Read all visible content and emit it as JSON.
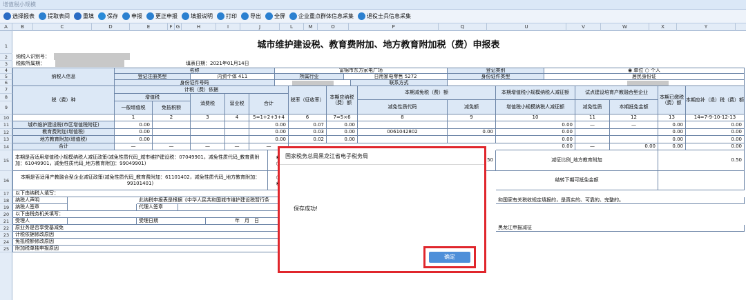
{
  "window": {
    "title": "增值税小规模"
  },
  "toolbar": [
    {
      "label": "选择报表",
      "icon": "list-icon",
      "color": "#2b6cc4"
    },
    {
      "label": "提取表间",
      "icon": "arrow-icon",
      "color": "#2b80d0"
    },
    {
      "label": "重填",
      "icon": "close-icon",
      "color": "#2b6cc4"
    },
    {
      "label": "保存",
      "icon": "check-icon",
      "color": "#2a8bd8"
    },
    {
      "label": "申报",
      "icon": "upload-icon",
      "color": "#2b80d0"
    },
    {
      "label": "更正申报",
      "icon": "cloud-icon",
      "color": "#2b80d0"
    },
    {
      "label": "填报说明",
      "icon": "help-icon",
      "color": "#2b80d0"
    },
    {
      "label": "打印",
      "icon": "printer-icon",
      "color": "#2b80d0"
    },
    {
      "label": "导出",
      "icon": "export-icon",
      "color": "#2b80d0"
    },
    {
      "label": "全屏",
      "icon": "fullscreen-icon",
      "color": "#2b80d0"
    },
    {
      "label": "企业重点群体信息采集",
      "icon": "cloud-icon",
      "color": "#2b80d0"
    },
    {
      "label": "退役士兵信息采集",
      "icon": "cloud-icon",
      "color": "#2b80d0"
    }
  ],
  "columns": [
    "A",
    "B",
    "C",
    "D",
    "E",
    "F",
    "G",
    "H",
    "I",
    "J",
    "L",
    "M",
    "O",
    "P",
    "Q",
    "U",
    "V",
    "W",
    "X",
    "Y"
  ],
  "rows": [
    "1",
    "2",
    "3",
    "4",
    "5",
    "6",
    "7",
    "8",
    "9",
    "10",
    "11",
    "12",
    "13",
    "14",
    "15",
    "16",
    "17",
    "18",
    "19",
    "20",
    "21",
    "22",
    "23",
    "24",
    "25"
  ],
  "form": {
    "title": "城市维护建设税、教育费附加、地方教育附加税（费）申报表",
    "taxpayer_id_label": "纳税人识别号：",
    "period_label": "税款所属期：",
    "fill_date": "填表日期：2021年01月14日",
    "info_label": "纳税人信息",
    "name_label": "名称",
    "name_value": "富锦市东方家电广场",
    "reg_label": "登记注册类型",
    "reg_value": "内资个体 411",
    "industry_label": "所属行业",
    "industry_value": "日用家电零售 5272",
    "idtype_label": "身份证件类型",
    "idno_label": "身份证件号码",
    "contact_label": "联系方式",
    "category_label": "登记类别",
    "unit_label": "单位",
    "individual_label": "个人",
    "id_type_value": "居民身份证",
    "tax_type_label": "税（费）种",
    "basis_label": "计税（费）依据",
    "vat_label": "增值税",
    "general_vat": "一般增值税",
    "exempt_vat": "免抵税额",
    "consumption_tax": "消费税",
    "business_tax": "营业税",
    "total": "合计",
    "rate_label": "税率（征收率）",
    "payable_label": "本期应纳税（费）额",
    "reduce_label": "本期减免税（费）额",
    "reduce_code": "减免性质代码",
    "reduce_amount": "减免额",
    "small_label": "本期增值税小规模纳税人减征额",
    "small_sub": "增值税小规模纳税人减征额",
    "pilot_label": "试点建设培育产教融合型企业",
    "pilot_code": "减免性质",
    "pilot_amount": "本期抵免金额",
    "paid_label": "本期已缴税（费）额",
    "due_label": "本期应补（退）税（费）额",
    "idx": [
      "1",
      "2",
      "3",
      "4",
      "5=1+2+3+4",
      "6",
      "7=5×6",
      "8",
      "9",
      "10",
      "11",
      "12",
      "13",
      "14=7-9-10-12-13"
    ],
    "rows": [
      {
        "name": "城市维护建设税(市区增值税附征)",
        "amt": "0.00",
        "total": "0.00",
        "rate": "0.07",
        "payable": "0.00",
        "code": "",
        "reduce": "",
        "small": "0.00",
        "pcode": "—",
        "pamt": "—",
        "paid": "0.00",
        "due": "0.00"
      },
      {
        "name": "教育费附加(增值税)",
        "amt": "0.00",
        "total": "0.00",
        "rate": "0.03",
        "payable": "0.00",
        "code": "0061042802",
        "reduce": "0.00",
        "small": "0.00",
        "pcode": "",
        "pamt": "",
        "paid": "0.00",
        "due": "0.00"
      },
      {
        "name": "地方教育附加(增值税)",
        "amt": "0.00",
        "total": "0.00",
        "rate": "0.02",
        "payable": "0.00",
        "code": "",
        "reduce": "",
        "small": "0.00",
        "pcode": "",
        "pamt": "",
        "paid": "0.00",
        "due": "0.00"
      }
    ],
    "sum_label": "合计",
    "dash": "—",
    "sum_small": "0.00",
    "sum_pamt": "0.00",
    "sum_paid": "0.00",
    "sum_due": "0.00",
    "policy1": "本期是否适用增值税小规模纳税人减征政策(减免性质代码_城市维护建设税：07049901，减免性质代码_教育费附加：61049901，减免性质代码_地方教育附加：99049901)",
    "ratio_label": "减征比例_地方教育附加",
    "ratio_value": "0.50",
    "ratio_partial": "50",
    "policy2": "本期是否适用产教融合型企业减征政策(减免性质代码_教育费附加：61101402，减免性质代码_地方教育附加：99101401)",
    "carry_label": "结转下期可抵免金额",
    "taxpayer_fill": "以下由纳税人填写：",
    "declare_label": "纳税人声明",
    "declare_text": "此纳税申报表是根据《中华人民共和国城市维护建设税暂行条",
    "declare_tail": "和国家有关税收规定填报的，是真实的、可靠的、完整的。",
    "sign_label": "纳税人签章",
    "agent_label": "代理人签章",
    "tax_office_fill": "以下由税务机关填写：",
    "receiver_label": "受理人",
    "receive_date_label": "受理日期",
    "ym_label": "年　月　日",
    "r22": "原业务是否享受基减免",
    "r22_right": "黑龙江申报减征",
    "r23": "计税依据修改原因",
    "r24": "免抵税额修改原因",
    "r25": "附加税单独申报原因"
  },
  "dialog": {
    "title": "国家税务总局黑龙江省电子税务局",
    "message": "保存成功!",
    "ok": "确定"
  }
}
